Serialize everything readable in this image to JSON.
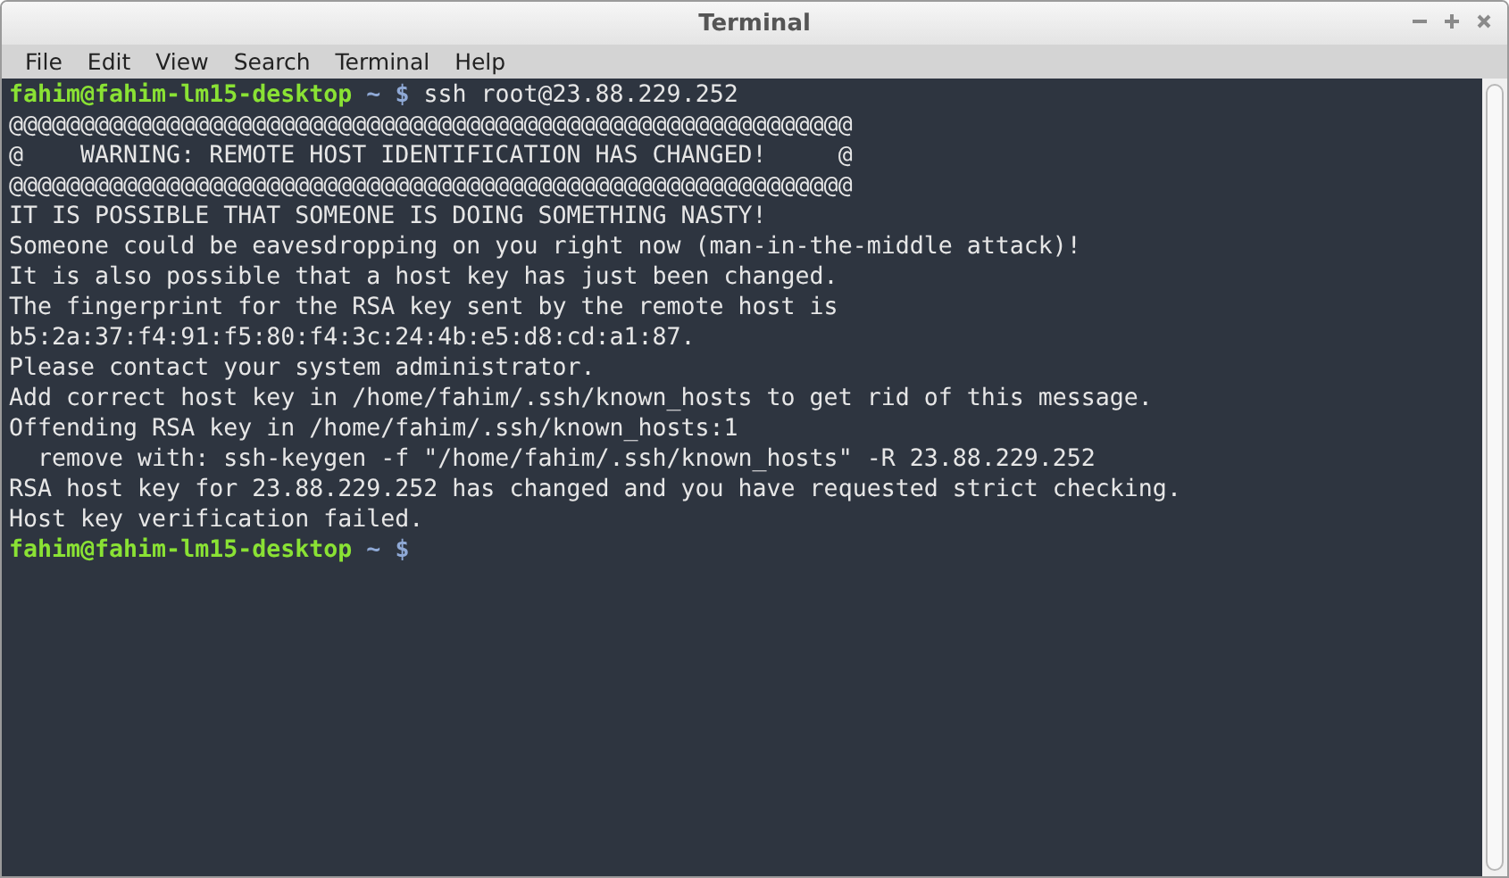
{
  "window": {
    "title": "Terminal"
  },
  "menu": [
    "File",
    "Edit",
    "View",
    "Search",
    "Terminal",
    "Help"
  ],
  "lines": [
    {
      "kind": "prompt",
      "user_host": "fahim@fahim-lm15-desktop",
      "path": "~",
      "symbol": "$",
      "command": "ssh root@23.88.229.252"
    },
    {
      "kind": "output",
      "text": "@@@@@@@@@@@@@@@@@@@@@@@@@@@@@@@@@@@@@@@@@@@@@@@@@@@@@@@@@@@"
    },
    {
      "kind": "output",
      "text": "@    WARNING: REMOTE HOST IDENTIFICATION HAS CHANGED!     @"
    },
    {
      "kind": "output",
      "text": "@@@@@@@@@@@@@@@@@@@@@@@@@@@@@@@@@@@@@@@@@@@@@@@@@@@@@@@@@@@"
    },
    {
      "kind": "output",
      "text": "IT IS POSSIBLE THAT SOMEONE IS DOING SOMETHING NASTY!"
    },
    {
      "kind": "output",
      "text": "Someone could be eavesdropping on you right now (man-in-the-middle attack)!"
    },
    {
      "kind": "output",
      "text": "It is also possible that a host key has just been changed."
    },
    {
      "kind": "output",
      "text": "The fingerprint for the RSA key sent by the remote host is"
    },
    {
      "kind": "output",
      "text": "b5:2a:37:f4:91:f5:80:f4:3c:24:4b:e5:d8:cd:a1:87."
    },
    {
      "kind": "output",
      "text": "Please contact your system administrator."
    },
    {
      "kind": "output",
      "text": "Add correct host key in /home/fahim/.ssh/known_hosts to get rid of this message."
    },
    {
      "kind": "output",
      "text": "Offending RSA key in /home/fahim/.ssh/known_hosts:1"
    },
    {
      "kind": "output",
      "text": "  remove with: ssh-keygen -f \"/home/fahim/.ssh/known_hosts\" -R 23.88.229.252"
    },
    {
      "kind": "output",
      "text": "RSA host key for 23.88.229.252 has changed and you have requested strict checking."
    },
    {
      "kind": "output",
      "text": "Host key verification failed."
    },
    {
      "kind": "prompt",
      "user_host": "fahim@fahim-lm15-desktop",
      "path": "~",
      "symbol": "$"
    }
  ]
}
